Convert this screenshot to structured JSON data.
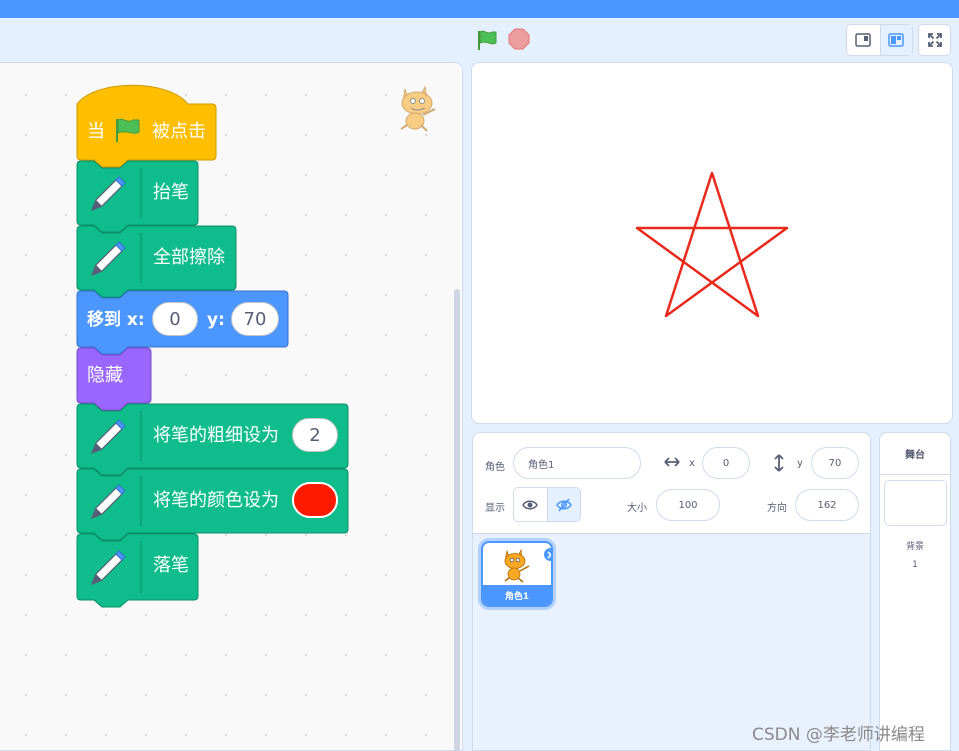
{
  "controls": {
    "green_flag_icon": "green-flag-icon",
    "stop_icon": "stop-icon"
  },
  "script": {
    "hat": {
      "prefix": "当",
      "suffix": "被点击"
    },
    "pen_up": "抬笔",
    "clear": "全部擦除",
    "go_to": {
      "label": "移到 x:",
      "x": "0",
      "y_label": "y:",
      "y": "70"
    },
    "hide": "隐藏",
    "set_pen_size": {
      "label": "将笔的粗细设为",
      "value": "2"
    },
    "set_pen_color": {
      "label": "将笔的颜色设为",
      "color": "#ff1a00"
    },
    "pen_down": "落笔"
  },
  "stage": {
    "star_color": "#e8291c"
  },
  "sprite_info": {
    "sprite_label": "角色",
    "sprite_name": "角色1",
    "x_label": "x",
    "x_value": "0",
    "y_label": "y",
    "y_value": "70",
    "show_label": "显示",
    "size_label": "大小",
    "size_value": "100",
    "direction_label": "方向",
    "direction_value": "162"
  },
  "sprite_list": [
    {
      "name": "角色1",
      "selected": true
    }
  ],
  "stage_pane": {
    "title": "舞台",
    "backdrops_label": "背景",
    "backdrops_count": "1"
  },
  "watermark": "CSDN @李老师讲编程",
  "colors": {
    "events": "#ffbf00",
    "pen": "#0fbd8c",
    "motion": "#4c97ff",
    "looks": "#9966ff",
    "accent": "#4c97ff"
  }
}
